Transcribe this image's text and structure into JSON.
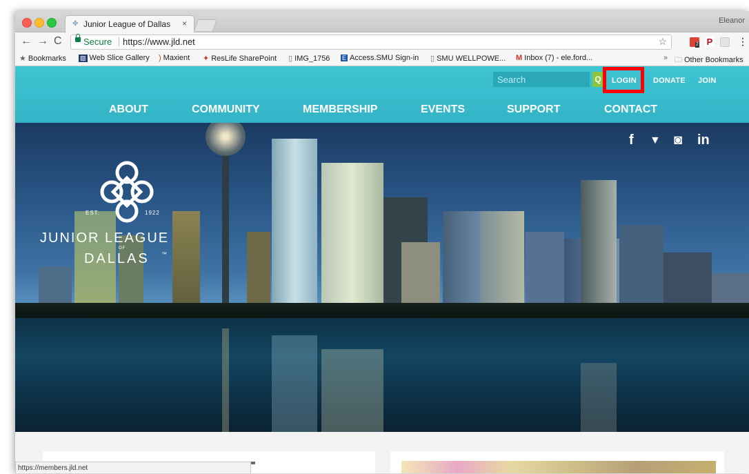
{
  "browser": {
    "tab_title": "Junior League of Dallas",
    "tab_close": "×",
    "profile_name": "Eleanor",
    "secure_label": "Secure",
    "url": "https://www.jld.net",
    "status_url": "https://members.jld.net"
  },
  "bookmarks": [
    {
      "label": "Bookmarks",
      "icon": "star-icon"
    },
    {
      "label": "Web Slice Gallery",
      "icon": "web-slice-icon"
    },
    {
      "label": "Maxient",
      "icon": "maxient-icon"
    },
    {
      "label": "ResLife SharePoint",
      "icon": "reslife-icon"
    },
    {
      "label": "IMG_1756",
      "icon": "page-icon"
    },
    {
      "label": "Access.SMU Sign-in",
      "icon": "smu-icon"
    },
    {
      "label": "SMU WELLPOWE...",
      "icon": "page-icon"
    },
    {
      "label": "Inbox (7) - ele.ford...",
      "icon": "gmail-icon"
    },
    {
      "label": "Other Bookmarks",
      "icon": "folder-icon"
    }
  ],
  "bookmarks_overflow": "»",
  "site": {
    "search_placeholder": "Search",
    "search_button": "Q",
    "utility_links": [
      "LOGIN",
      "DONATE",
      "JOIN"
    ],
    "main_nav": [
      "ABOUT",
      "COMMUNITY",
      "MEMBERSHIP",
      "EVENTS",
      "SUPPORT",
      "CONTACT"
    ],
    "social": [
      {
        "icon": "facebook-icon",
        "glyph": "f"
      },
      {
        "icon": "twitter-icon",
        "glyph": "🐦"
      },
      {
        "icon": "instagram-icon",
        "glyph": "◙"
      },
      {
        "icon": "linkedin-icon",
        "glyph": "in"
      }
    ],
    "logo": {
      "est": "EST.",
      "year": "1922",
      "line1": "JUNIOR LEAGUE",
      "of": "OF",
      "line2": "DALLAS",
      "tm": "™"
    }
  },
  "colors": {
    "header": "#3fc4d3",
    "highlight": "#ff0000",
    "search_button": "#8cc63f"
  }
}
